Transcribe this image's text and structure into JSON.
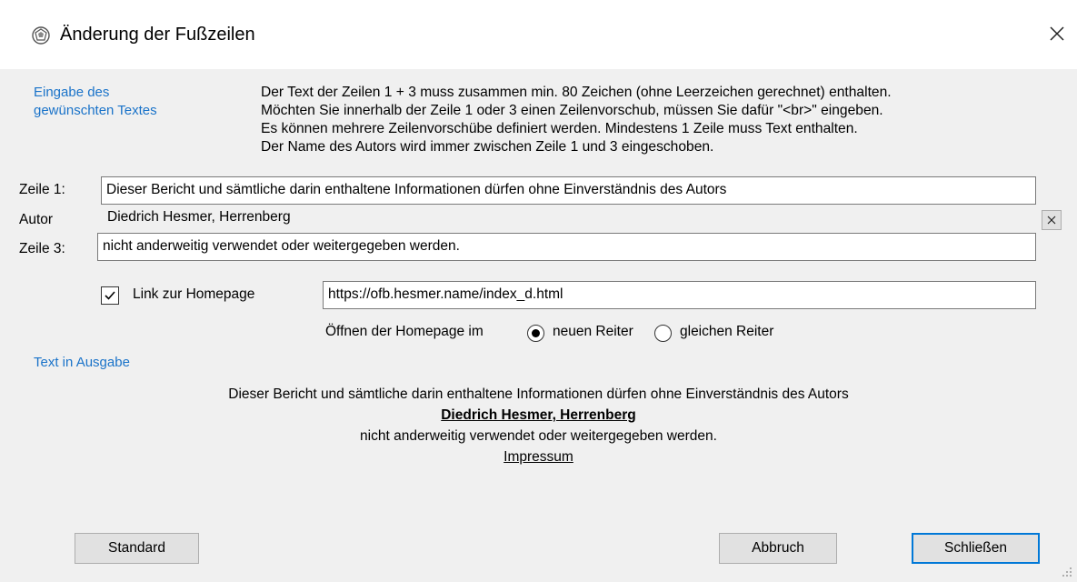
{
  "window": {
    "title": "Änderung der Fußzeilen",
    "icon": "app-emblem-icon",
    "close_icon": "close-icon"
  },
  "input_section": {
    "label": "Eingabe des\ngewünschten Textes",
    "hint_lines": [
      "Der Text der Zeilen 1 + 3 muss zusammen min. 80 Zeichen (ohne Leerzeichen gerechnet) enthalten.",
      "Möchten Sie innerhalb der Zeile 1 oder 3 einen Zeilenvorschub, müssen Sie dafür \"<br>\" eingeben.",
      "Es können mehrere Zeilenvorschübe definiert werden. Mindestens 1 Zeile muss Text enthalten.",
      "Der Name des Autors wird immer zwischen Zeile 1 und 3 eingeschoben."
    ]
  },
  "fields": {
    "line1_label": "Zeile 1:",
    "line1_value": "Dieser Bericht und sämtliche darin enthaltene Informationen dürfen ohne Einverständnis des Autors",
    "author_label": "Autor",
    "author_value": "Diedrich Hesmer, Herrenberg",
    "line3_label": "Zeile 3:",
    "line3_value": "nicht anderweitig verwendet oder weitergegeben werden."
  },
  "homepage": {
    "checkbox_label": "Link zur Homepage",
    "checked": true,
    "url": "https://ofb.hesmer.name/index_d.html",
    "open_label": "Öffnen der Homepage im",
    "option_new": "neuen Reiter",
    "option_same": "gleichen Reiter",
    "selected": "new"
  },
  "output_section": {
    "label": "Text in Ausgabe",
    "line1": "Dieser Bericht und sämtliche darin enthaltene Informationen dürfen ohne Einverständnis des Autors",
    "author": "Diedrich Hesmer, Herrenberg",
    "line3": "nicht anderweitig verwendet oder weitergegeben werden.",
    "link": "Impressum"
  },
  "buttons": {
    "standard": "Standard",
    "cancel": "Abbruch",
    "close": "Schließen"
  },
  "colors": {
    "section_label": "#1a73c9",
    "dialog_bg": "#f0f0f0",
    "default_button_border": "#0078d7"
  }
}
